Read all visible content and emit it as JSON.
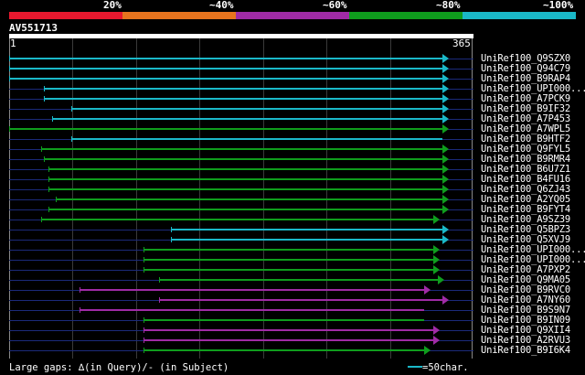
{
  "legend": {
    "labels": [
      "20%",
      "~40%",
      "~60%",
      "~80%",
      "~100%"
    ],
    "colors": [
      "#e8182e",
      "#e8741e",
      "#a02ba6",
      "#0f9d1d",
      "#1ab8c8"
    ]
  },
  "query": {
    "name": "AV551713",
    "start_label": "1",
    "end_label": "365",
    "length": 365
  },
  "hits": [
    {
      "name": "UniRef100_Q9SZX0",
      "class": 4,
      "start": 1,
      "end": 365,
      "arrow": "right"
    },
    {
      "name": "UniRef100_Q94C79",
      "class": 4,
      "start": 1,
      "end": 365,
      "arrow": "right"
    },
    {
      "name": "UniRef100_B9RAP4",
      "class": 4,
      "start": 1,
      "end": 365,
      "arrow": "right"
    },
    {
      "name": "UniRef100_UPI000...",
      "class": 4,
      "start": 30,
      "end": 365,
      "arrow": "right"
    },
    {
      "name": "UniRef100_A7PCK9",
      "class": 4,
      "start": 30,
      "end": 365,
      "arrow": "right"
    },
    {
      "name": "UniRef100_B9IF32",
      "class": 4,
      "start": 53,
      "end": 365,
      "arrow": "right"
    },
    {
      "name": "UniRef100_A7P453",
      "class": 4,
      "start": 37,
      "end": 365,
      "arrow": "right"
    },
    {
      "name": "UniRef100_A7WPL5",
      "class": 3,
      "start": 1,
      "end": 365,
      "arrow": "right"
    },
    {
      "name": "UniRef100_B9HTF2",
      "class": 4,
      "start": 53,
      "end": 365,
      "arrow": "none"
    },
    {
      "name": "UniRef100_Q9FYL5",
      "class": 3,
      "start": 28,
      "end": 365,
      "arrow": "right"
    },
    {
      "name": "UniRef100_B9RMR4",
      "class": 3,
      "start": 30,
      "end": 365,
      "arrow": "right"
    },
    {
      "name": "UniRef100_B6U7Z1",
      "class": 3,
      "start": 34,
      "end": 365,
      "arrow": "right"
    },
    {
      "name": "UniRef100_B4FU16",
      "class": 3,
      "start": 34,
      "end": 365,
      "arrow": "right"
    },
    {
      "name": "UniRef100_Q6ZJ43",
      "class": 3,
      "start": 34,
      "end": 365,
      "arrow": "right"
    },
    {
      "name": "UniRef100_A2YQ05",
      "class": 3,
      "start": 40,
      "end": 365,
      "arrow": "right"
    },
    {
      "name": "UniRef100_B9FYT4",
      "class": 3,
      "start": 34,
      "end": 365,
      "arrow": "right"
    },
    {
      "name": "UniRef100_A9SZ39",
      "class": 3,
      "start": 28,
      "end": 357,
      "arrow": "right"
    },
    {
      "name": "UniRef100_Q5BPZ3",
      "class": 4,
      "start": 137,
      "end": 365,
      "arrow": "right"
    },
    {
      "name": "UniRef100_Q5XVJ9",
      "class": 4,
      "start": 137,
      "end": 365,
      "arrow": "right"
    },
    {
      "name": "UniRef100_UPI000...",
      "class": 3,
      "start": 114,
      "end": 357,
      "arrow": "right"
    },
    {
      "name": "UniRef100_UPI000...",
      "class": 3,
      "start": 114,
      "end": 357,
      "arrow": "right"
    },
    {
      "name": "UniRef100_A7PXP2",
      "class": 3,
      "start": 114,
      "end": 357,
      "arrow": "right"
    },
    {
      "name": "UniRef100_Q9MA05",
      "class": 3,
      "start": 127,
      "end": 361,
      "arrow": "right"
    },
    {
      "name": "UniRef100_B9RVC0",
      "class": 2,
      "start": 60,
      "end": 350,
      "arrow": "right"
    },
    {
      "name": "UniRef100_A7NY60",
      "class": 2,
      "start": 127,
      "end": 365,
      "arrow": "right"
    },
    {
      "name": "UniRef100_B9S9N7",
      "class": 2,
      "start": 60,
      "end": 350,
      "arrow": "none"
    },
    {
      "name": "UniRef100_B9IN09",
      "class": 3,
      "start": 114,
      "end": 350,
      "arrow": "none"
    },
    {
      "name": "UniRef100_Q9XII4",
      "class": 2,
      "start": 114,
      "end": 357,
      "arrow": "right"
    },
    {
      "name": "UniRef100_A2RVU3",
      "class": 2,
      "start": 114,
      "end": 357,
      "arrow": "right"
    },
    {
      "name": "UniRef100_B9I6K4",
      "class": 3,
      "start": 114,
      "end": 350,
      "arrow": "right"
    }
  ],
  "footer": {
    "gap_note": "Large gaps: ∆(in Query)/- (in Subject)",
    "scale_text": "=50char."
  }
}
